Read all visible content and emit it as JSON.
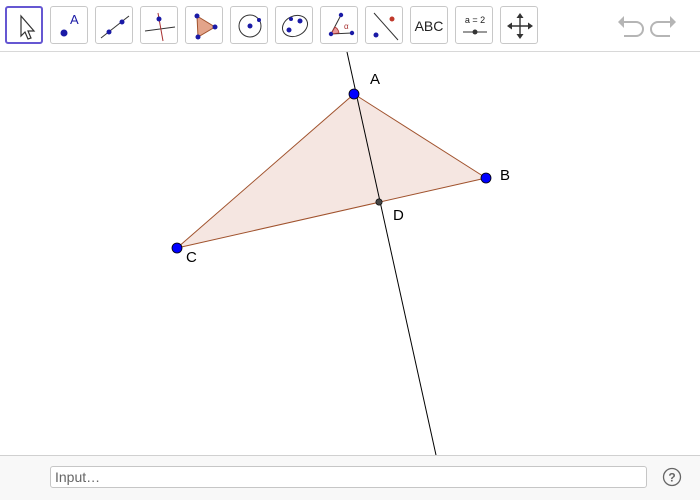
{
  "toolbar": {
    "tools": [
      {
        "name": "move-tool",
        "icon": "arrow-cursor-icon",
        "active": true
      },
      {
        "name": "point-tool",
        "icon": "point-icon",
        "label": "A"
      },
      {
        "name": "line-tool",
        "icon": "line-icon"
      },
      {
        "name": "perpendicular-tool",
        "icon": "perpendicular-line-icon"
      },
      {
        "name": "polygon-tool",
        "icon": "polygon-icon"
      },
      {
        "name": "circle-tool",
        "icon": "circle-center-point-icon"
      },
      {
        "name": "conic-tool",
        "icon": "ellipse-icon"
      },
      {
        "name": "angle-tool",
        "icon": "angle-icon",
        "label": "α"
      },
      {
        "name": "reflect-tool",
        "icon": "reflect-icon"
      },
      {
        "name": "text-tool",
        "icon": "text-icon",
        "label": "ABC"
      },
      {
        "name": "slider-tool",
        "icon": "slider-icon",
        "label": "a = 2"
      },
      {
        "name": "move-graphics-tool",
        "icon": "move-view-icon"
      }
    ],
    "undo_icon": "undo-icon",
    "redo_icon": "redo-icon"
  },
  "graphics": {
    "points": {
      "A": "A",
      "B": "B",
      "C": "C",
      "D": "D"
    },
    "colors": {
      "point_fill": "#0000ff",
      "polygon_fill": "#f5e6e1",
      "polygon_edge": "#a0522d",
      "line": "#000000"
    }
  },
  "input_bar": {
    "placeholder": "Input…",
    "help_icon": "help-icon"
  }
}
